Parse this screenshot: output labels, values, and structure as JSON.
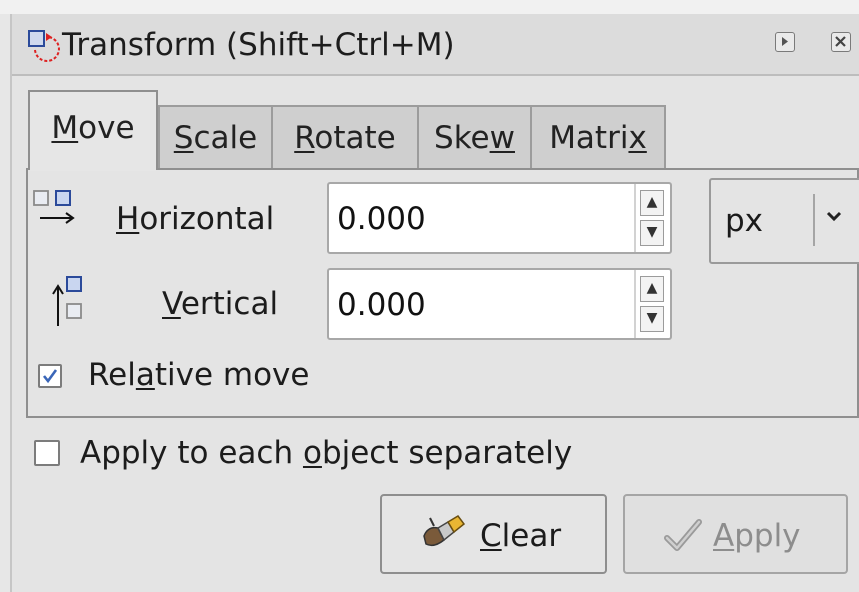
{
  "window": {
    "title": "Transform (Shift+Ctrl+M)"
  },
  "tabs": [
    {
      "label": "Move",
      "mnemonic_index": 0,
      "active": true
    },
    {
      "label": "Scale",
      "mnemonic_index": 0,
      "active": false
    },
    {
      "label": "Rotate",
      "mnemonic_index": 0,
      "active": false
    },
    {
      "label": "Skew",
      "mnemonic_index": 3,
      "active": false
    },
    {
      "label": "Matrix",
      "mnemonic_index": 5,
      "active": false
    }
  ],
  "move": {
    "horizontal": {
      "label": "Horizontal",
      "value": "0.000",
      "icon": "arrow-right-icon"
    },
    "vertical": {
      "label": "Vertical",
      "value": "0.000",
      "icon": "arrow-up-icon"
    },
    "unit": "px",
    "relative_move": {
      "label": "Relative move",
      "checked": true
    }
  },
  "apply_each": {
    "label": "Apply to each object separately",
    "checked": false
  },
  "buttons": {
    "clear": {
      "label": "Clear",
      "icon": "brush-icon"
    },
    "apply": {
      "label": "Apply",
      "icon": "checkmark-icon",
      "enabled": false
    }
  },
  "colors": {
    "background": "#e4e4e4",
    "titlebar": "#dcdcdc",
    "check_blue": "#3a66b8",
    "disabled_text": "#8d8d8d"
  }
}
